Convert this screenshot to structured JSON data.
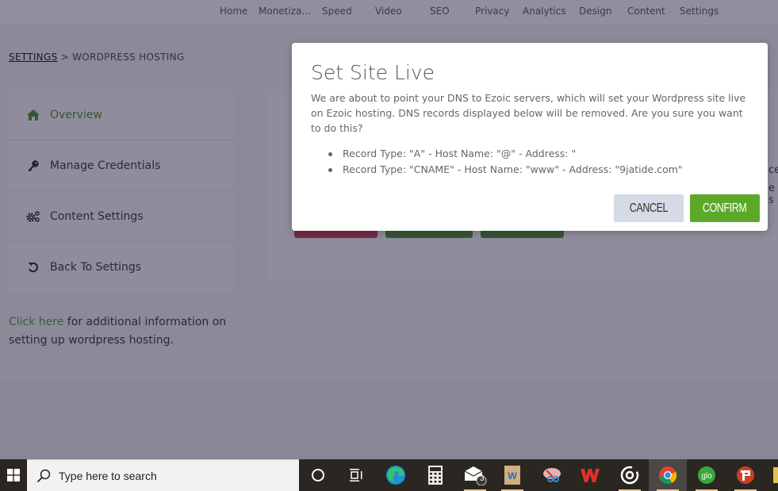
{
  "topnav": {
    "items": [
      "Home",
      "Monetiza...",
      "Speed",
      "Video",
      "SEO",
      "Privacy",
      "Analytics",
      "Design",
      "Content",
      "Settings"
    ]
  },
  "breadcrumb": {
    "root": "SETTINGS",
    "separator": ">",
    "current": "WORDPRESS HOSTING"
  },
  "sidebar": {
    "items": [
      {
        "label": "Overview",
        "icon": "home-icon",
        "active": true
      },
      {
        "label": "Manage Credentials",
        "icon": "key-icon",
        "active": false
      },
      {
        "label": "Content Settings",
        "icon": "cogs-icon",
        "active": false
      },
      {
        "label": "Back To Settings",
        "icon": "undo-icon",
        "active": false
      }
    ]
  },
  "help": {
    "link_text": "Click here",
    "text": " for additional information on setting up wordpress hosting."
  },
  "background_partial_text": [
    "ce",
    "e s"
  ],
  "modal": {
    "title": "Set Site Live",
    "body": "We are about to point your DNS to Ezoic servers, which will set your Wordpress site live on Ezoic hosting. DNS records displayed below will be removed. Are you sure you want to do this?",
    "records": [
      "Record Type: \"A\" - Host Name: \"@\" - Address: \"",
      "Record Type: \"CNAME\" - Host Name: \"www\" - Address: \"9jatide.com\""
    ],
    "cancel_label": "CANCEL",
    "confirm_label": "CONFIRM"
  },
  "colors": {
    "accent_green": "#5ca92a",
    "cancel_bg": "#d4dbe6",
    "danger_red": "#a8203a",
    "overlay": "rgba(35,32,60,0.5)"
  },
  "taskbar": {
    "search_placeholder": "Type here to search",
    "mail_badge": "3",
    "apps": [
      "cortana",
      "task-view",
      "edge",
      "calculator",
      "mail",
      "word",
      "snipping-tool",
      "wps-office",
      "groove",
      "chrome",
      "glo",
      "psiphon"
    ]
  }
}
